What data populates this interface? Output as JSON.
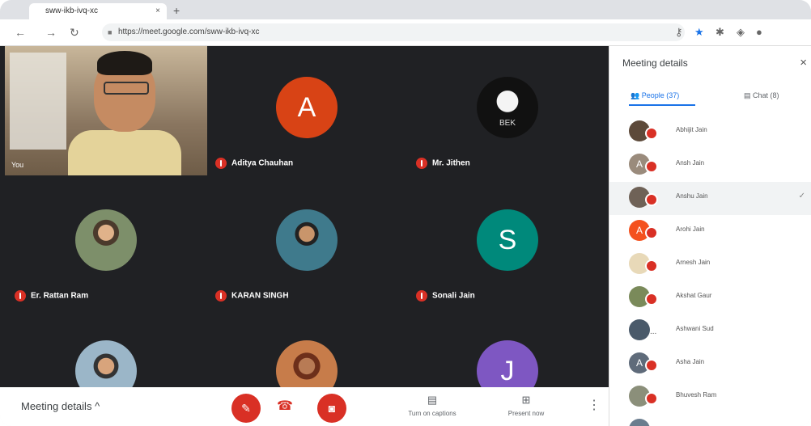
{
  "browser": {
    "tab_title": "sww-ikb-ivq-xc",
    "tab_close": "×",
    "new_tab": "+",
    "back": "←",
    "forward": "→",
    "reload": "↻",
    "url": "https://meet.google.com/sww-ikb-ivq-xc"
  },
  "self_view": {
    "label": "You"
  },
  "tiles": [
    {
      "name": "Aditya Chauhan",
      "initial": "A",
      "color": "#d84315"
    },
    {
      "name": "Mr. Jithen",
      "avatar_text": "BEK"
    },
    {
      "name": "Er. Rattan Ram"
    },
    {
      "name": "KARAN SINGH"
    },
    {
      "name": "Sonali Jain",
      "initial": "S",
      "color": "#00897b"
    },
    {
      "name": ""
    },
    {
      "name": ""
    },
    {
      "name": "",
      "initial": "J",
      "color": "#7e57c2"
    }
  ],
  "bottom_bar": {
    "meeting_details": "Meeting details",
    "meeting_details_chevron": "^",
    "mic_icon": "✎",
    "hangup_icon": "☎",
    "camera_icon": "◙",
    "captions_icon": "▤",
    "captions_label": "Turn on captions",
    "present_icon": "⊞",
    "present_label": "Present now",
    "more_icon": "⋮"
  },
  "panel": {
    "title": "Meeting details",
    "close": "×",
    "people_tab": "People (37)",
    "chat_tab": "Chat (8)",
    "people": [
      {
        "name": "Abhijit Jain",
        "initial": "",
        "highlight": false
      },
      {
        "name": "Ansh Jain",
        "initial": "A",
        "highlight": false
      },
      {
        "name": "Anshu Jain",
        "initial": "",
        "highlight": true
      },
      {
        "name": "Arohi Jain",
        "initial": "A",
        "highlight": false,
        "color": "#f4511e"
      },
      {
        "name": "Arnesh Jain",
        "initial": "",
        "highlight": false
      },
      {
        "name": "Akshat Gaur",
        "initial": "",
        "highlight": false
      },
      {
        "name": "Ashwani Sud",
        "initial": "",
        "highlight": false,
        "gray": true
      },
      {
        "name": "Asha Jain",
        "initial": "A",
        "highlight": false
      },
      {
        "name": "Bhuvesh Ram",
        "initial": "",
        "highlight": false
      },
      {
        "name": "",
        "initial": "",
        "highlight": false
      }
    ],
    "check_icon": "✓",
    "more_ellipsis": "..."
  },
  "colors": {
    "muted_red": "#d93025",
    "accent": "#1a73e8",
    "grid_bg": "#202124"
  }
}
